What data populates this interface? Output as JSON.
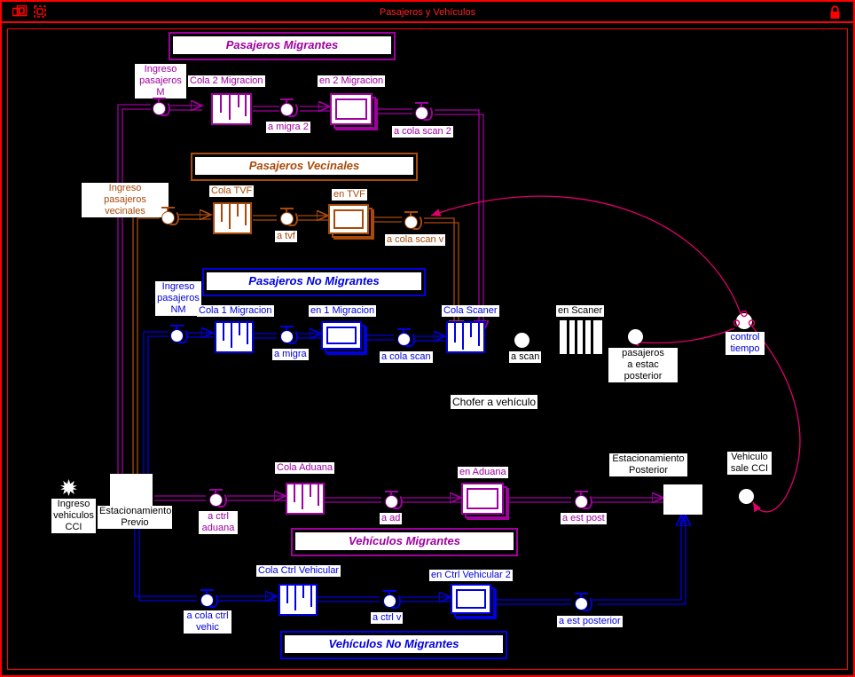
{
  "window": {
    "title": "Pasajeros y Vehículos",
    "icons": [
      "window-restore-icon",
      "window-select-icon",
      "lock-icon"
    ],
    "accent": "#ff0000"
  },
  "colors": {
    "migrantes": "#a000a0",
    "vecinales": "#a94a0a",
    "no_migrantes": "#0000e0",
    "neutral": "#000000",
    "pink": "#e0006a",
    "border": "#ff0000"
  },
  "banners": [
    {
      "id": "pasajeros-migrantes",
      "label": "Pasajeros Migrantes",
      "color": "#a000a0"
    },
    {
      "id": "pasajeros-vecinales",
      "label": "Pasajeros Vecinales",
      "color": "#a94a0a"
    },
    {
      "id": "pasajeros-no-migrantes",
      "label": "Pasajeros No Migrantes",
      "color": "#0000e0"
    },
    {
      "id": "vehiculos-migrantes",
      "label": "Vehículos Migrantes",
      "color": "#a000a0"
    },
    {
      "id": "vehiculos-no-migrantes",
      "label": "Vehículos No Migrantes",
      "color": "#0000e0"
    }
  ],
  "rows": {
    "migrantes": {
      "source_label": "Ingreso\npasajeros M",
      "source_line1": "Ingreso",
      "source_line2": "pasajeros M",
      "queue_label": "Cola 2 Migracion",
      "activity1_label": "a migra 2",
      "server_label": "en 2 Migracion",
      "activity2_label": "a cola scan 2"
    },
    "vecinales": {
      "source_line1": "Ingreso",
      "source_line2": "pasajeros vecinales",
      "queue_label": "Cola TVF",
      "activity1_label": "a tvf",
      "server_label": "en TVF",
      "activity2_label": "a cola scan v"
    },
    "no_migrantes": {
      "source_line1": "Ingreso",
      "source_line2": "pasajeros",
      "source_line3": "NM",
      "queue_label": "Cola 1 Migracion",
      "activity1_label": "a migra",
      "server_label": "en 1 Migracion",
      "activity2_label": "a cola scan"
    },
    "scanner": {
      "queue_label": "Cola Scaner",
      "activity_label": "a scan",
      "server_label": "en Scaner",
      "exit_line1": "pasajeros",
      "exit_line2": "a estac posterior"
    },
    "vehiculos_migrantes": {
      "source_line1": "Ingreso",
      "source_line2": "vehiculos",
      "source_line3": "CCI",
      "parking_line1": "Estacionamiento",
      "parking_line2": "Previo",
      "activity1_line1": "a ctrl",
      "activity1_line2": "aduana",
      "queue_label": "Cola Aduana",
      "activity2_label": "a ad",
      "server_label": "en Aduana",
      "activity3_label": "a est post",
      "parking_post_line1": "Estacionamiento",
      "parking_post_line2": "Posterior",
      "exit_line1": "Vehiculo",
      "exit_line2": "sale CCI"
    },
    "vehiculos_no_migrantes": {
      "activity1_line1": "a cola ctrl",
      "activity1_line2": "vehic",
      "queue_label": "Cola Ctrl Vehicular",
      "activity2_label": "a ctrl v",
      "server_label": "en Ctrl Vehicular 2",
      "activity3_label": "a est posterior"
    }
  },
  "annotations": {
    "chofer": "Chofer a vehículo",
    "control_line1": "control",
    "control_line2": "tiempo"
  }
}
